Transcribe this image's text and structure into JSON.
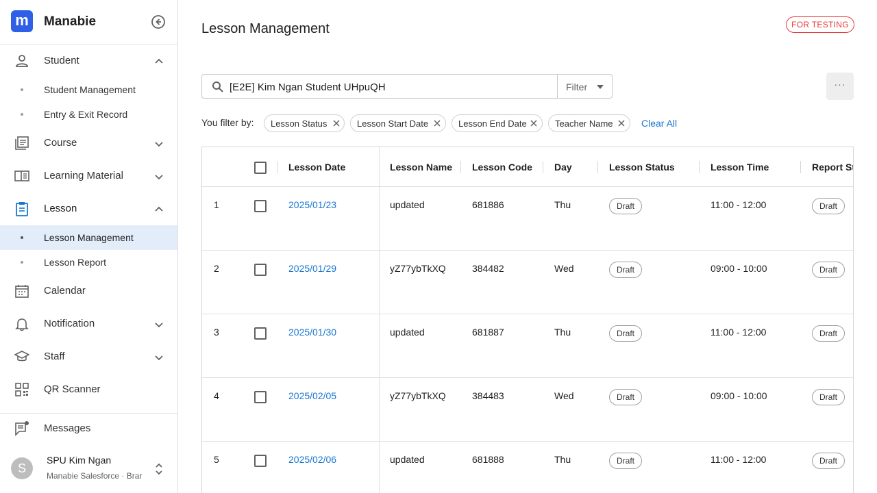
{
  "app": {
    "brand_name": "Manabie",
    "logo_letter": "m",
    "env_badge": "FOR TESTING"
  },
  "sidebar": {
    "items": [
      {
        "label": "Student",
        "icon": "person-icon",
        "expanded": true
      },
      {
        "label": "Course",
        "icon": "course-icon",
        "expanded": false
      },
      {
        "label": "Learning Material",
        "icon": "book-open-icon",
        "expanded": false
      },
      {
        "label": "Lesson",
        "icon": "clipboard-icon",
        "expanded": true,
        "active": true
      },
      {
        "label": "Calendar",
        "icon": "calendar-icon"
      },
      {
        "label": "Notification",
        "icon": "bell-icon",
        "expanded": false
      },
      {
        "label": "Staff",
        "icon": "graduation-cap-icon",
        "expanded": false
      },
      {
        "label": "QR Scanner",
        "icon": "qr-code-icon"
      },
      {
        "label": "Messages",
        "icon": "chat-icon"
      }
    ],
    "student_sub": [
      "Student Management",
      "Entry & Exit Record"
    ],
    "lesson_sub": [
      "Lesson Management",
      "Lesson Report"
    ],
    "active_sub": "Lesson Management"
  },
  "user": {
    "avatar_letter": "S",
    "name": "SPU Kim Ngan",
    "org": "Manabie Salesforce · Brar"
  },
  "main": {
    "title": "Lesson Management",
    "search_value": "[E2E] Kim Ngan Student UHpuQH",
    "filter_label": "Filter",
    "more_label": "···",
    "filter_by_label": "You filter by:",
    "chips": [
      "Lesson Status",
      "Lesson Start Date",
      "Lesson End Date",
      "Teacher Name"
    ],
    "clear_all": "Clear All"
  },
  "table": {
    "columns": [
      "Lesson Date",
      "Lesson Name",
      "Lesson Code",
      "Day",
      "Lesson Status",
      "Lesson Time",
      "Report St"
    ],
    "rows": [
      {
        "num": "1",
        "date": "2025/01/23",
        "name": "updated",
        "code": "681886",
        "day": "Thu",
        "status": "Draft",
        "time": "11:00 - 12:00",
        "report": "Draft"
      },
      {
        "num": "2",
        "date": "2025/01/29",
        "name": "yZ77ybTkXQ",
        "code": "384482",
        "day": "Wed",
        "status": "Draft",
        "time": "09:00 - 10:00",
        "report": "Draft"
      },
      {
        "num": "3",
        "date": "2025/01/30",
        "name": "updated",
        "code": "681887",
        "day": "Thu",
        "status": "Draft",
        "time": "11:00 - 12:00",
        "report": "Draft"
      },
      {
        "num": "4",
        "date": "2025/02/05",
        "name": "yZ77ybTkXQ",
        "code": "384483",
        "day": "Wed",
        "status": "Draft",
        "time": "09:00 - 10:00",
        "report": "Draft"
      },
      {
        "num": "5",
        "date": "2025/02/06",
        "name": "updated",
        "code": "681888",
        "day": "Thu",
        "status": "Draft",
        "time": "11:00 - 12:00",
        "report": "Draft"
      }
    ]
  },
  "colors": {
    "brand": "#2f5fe6",
    "link": "#1976d2",
    "active_bg": "#e3ecf9",
    "test_badge": "#e53935"
  }
}
